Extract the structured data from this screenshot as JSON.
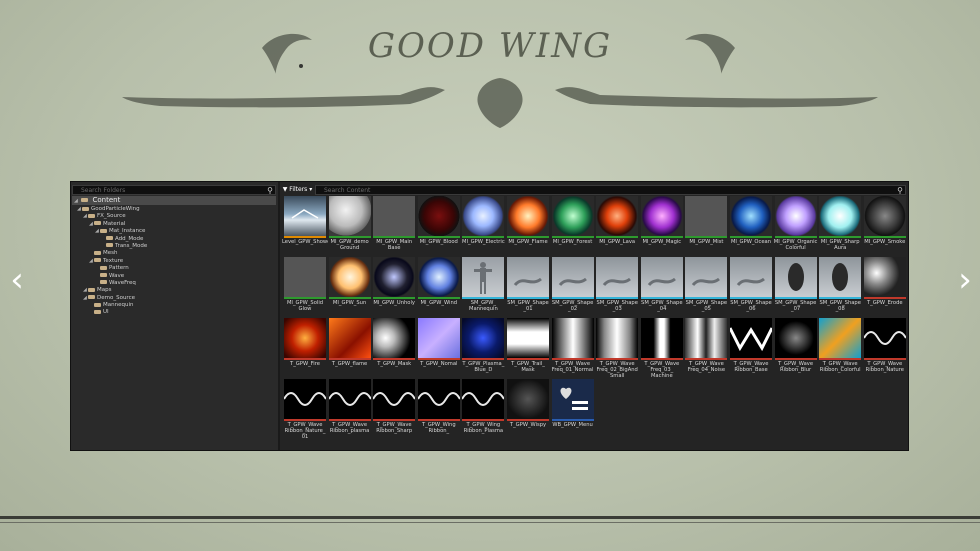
{
  "title": "GOOD WING",
  "browser": {
    "search_folders_placeholder": "Search Folders",
    "search_content_placeholder": "Search Content",
    "filters_label": "▼ Filters ▾",
    "content_label": "Content",
    "tree": [
      {
        "label": "GoodParticleWing",
        "depth": 1,
        "expanded": true
      },
      {
        "label": "FX_Source",
        "depth": 2,
        "expanded": true
      },
      {
        "label": "Material",
        "depth": 3,
        "expanded": true
      },
      {
        "label": "Mat_Instance",
        "depth": 4,
        "expanded": true
      },
      {
        "label": "Add_Mode",
        "depth": 5,
        "expanded": false
      },
      {
        "label": "Trans_Mode",
        "depth": 5,
        "expanded": false
      },
      {
        "label": "Mesh",
        "depth": 3,
        "expanded": false
      },
      {
        "label": "Texture",
        "depth": 3,
        "expanded": true
      },
      {
        "label": "Pattern",
        "depth": 4,
        "expanded": false
      },
      {
        "label": "Wave",
        "depth": 4,
        "expanded": false
      },
      {
        "label": "WaveFreq",
        "depth": 4,
        "expanded": false
      },
      {
        "label": "Maps",
        "depth": 2,
        "expanded": true
      },
      {
        "label": "Demo_Source",
        "depth": 2,
        "expanded": true
      },
      {
        "label": "Mannequin",
        "depth": 3,
        "expanded": false
      },
      {
        "label": "UI",
        "depth": 3,
        "expanded": false
      }
    ],
    "assets": [
      {
        "label": "Level_GPW_Showcase_Interaction",
        "bar": "#e08a00",
        "kind": "level"
      },
      {
        "label": "MI_GPW_demo Ground",
        "bar": "#2e9a2e",
        "kind": "sphere-white"
      },
      {
        "label": "MI_GPW_Main Base",
        "bar": "#2e9a2e",
        "kind": "checker"
      },
      {
        "label": "MI_GPW_Blood",
        "bar": "#2e9a2e",
        "kind": "blood"
      },
      {
        "label": "MI_GPW_Electric",
        "bar": "#2e9a2e",
        "kind": "electric"
      },
      {
        "label": "MI_GPW_Flame",
        "bar": "#2e9a2e",
        "kind": "flame"
      },
      {
        "label": "MI_GPW_Forest",
        "bar": "#2e9a2e",
        "kind": "forest"
      },
      {
        "label": "MI_GPW_Lava",
        "bar": "#2e9a2e",
        "kind": "lava"
      },
      {
        "label": "MI_GPW_Magic",
        "bar": "#2e9a2e",
        "kind": "magic"
      },
      {
        "label": "MI_GPW_Mist",
        "bar": "#2e9a2e",
        "kind": "checker"
      },
      {
        "label": "MI_GPW_Ocean",
        "bar": "#2e9a2e",
        "kind": "ocean"
      },
      {
        "label": "MI_GPW_Organic Colorful",
        "bar": "#2e9a2e",
        "kind": "organic"
      },
      {
        "label": "MI_GPW_Sharp Aura",
        "bar": "#2e9a2e",
        "kind": "aura"
      },
      {
        "label": "MI_GPW_Smoke",
        "bar": "#2e9a2e",
        "kind": "smoke"
      },
      {
        "label": "MI_GPW_Solid Glow",
        "bar": "#2e9a2e",
        "kind": "checker-blue"
      },
      {
        "label": "MI_GPW_Sun",
        "bar": "#2e9a2e",
        "kind": "sun"
      },
      {
        "label": "MI_GPW_Unholy",
        "bar": "#2e9a2e",
        "kind": "unholy"
      },
      {
        "label": "MI_GPW_Wind",
        "bar": "#2e9a2e",
        "kind": "wind"
      },
      {
        "label": "SM_GPW_ Mannequin",
        "bar": "#34b4d8",
        "kind": "mannequin"
      },
      {
        "label": "SM_GPW_Shape _01",
        "bar": "#34b4d8",
        "kind": "shape"
      },
      {
        "label": "SM_GPW_Shape _02",
        "bar": "#34b4d8",
        "kind": "shape"
      },
      {
        "label": "SM_GPW_Shape _03",
        "bar": "#34b4d8",
        "kind": "shape"
      },
      {
        "label": "SM_GPW_Shape _04",
        "bar": "#34b4d8",
        "kind": "shape"
      },
      {
        "label": "SM_GPW_Shape _05",
        "bar": "#34b4d8",
        "kind": "shape"
      },
      {
        "label": "SM_GPW_Shape _06",
        "bar": "#34b4d8",
        "kind": "shape"
      },
      {
        "label": "SM_GPW_Shape _07",
        "bar": "#34b4d8",
        "kind": "shape-dark"
      },
      {
        "label": "SM_GPW_Shape _08",
        "bar": "#34b4d8",
        "kind": "shape-dark"
      },
      {
        "label": "T_GPW_Erode",
        "bar": "#c0392b",
        "kind": "erode"
      },
      {
        "label": "T_GPW_Fire",
        "bar": "#c0392b",
        "kind": "fire"
      },
      {
        "label": "T_GPW_flame",
        "bar": "#c0392b",
        "kind": "flametex"
      },
      {
        "label": "T_GPW_Mask",
        "bar": "#c0392b",
        "kind": "mask"
      },
      {
        "label": "T_GPW_Nomal",
        "bar": "#c0392b",
        "kind": "normal"
      },
      {
        "label": "T_GPW_Plasma_ Blue_D",
        "bar": "#c0392b",
        "kind": "plasma"
      },
      {
        "label": "T_GPW_Trail_ Mask",
        "bar": "#c0392b",
        "kind": "trailmask"
      },
      {
        "label": "T_GPW_Wave Freq_01_Normal",
        "bar": "#c0392b",
        "kind": "freq1"
      },
      {
        "label": "T_GPW_Wave Freq_02_BigAnd Small",
        "bar": "#c0392b",
        "kind": "freq2"
      },
      {
        "label": "T_GPW_Wave Freq_03_ Machine",
        "bar": "#c0392b",
        "kind": "freq3"
      },
      {
        "label": "T_GPW_Wave Freq_04_Noise",
        "bar": "#c0392b",
        "kind": "freq4"
      },
      {
        "label": "T_GPW_Wave Ribbon_Base",
        "bar": "#c0392b",
        "kind": "ribbonbase"
      },
      {
        "label": "T_GPW_Wave Ribbon_Blur",
        "bar": "#c0392b",
        "kind": "ribbonblur"
      },
      {
        "label": "T_GPW_Wave Ribbon_Colorful",
        "bar": "#c0392b",
        "kind": "ribboncolor"
      },
      {
        "label": "T_GPW_Wave Ribbon_Nature",
        "bar": "#c0392b",
        "kind": "ribbonnature"
      },
      {
        "label": "T_GPW_Wave Ribbon_Nature_ 01",
        "bar": "#c0392b",
        "kind": "ribbonnature2"
      },
      {
        "label": "T_GPW_Wave Ribbon_plasma",
        "bar": "#c0392b",
        "kind": "ribbonplasma"
      },
      {
        "label": "T_GPW_Wave Ribbon_Sharp",
        "bar": "#c0392b",
        "kind": "ribbonsharp"
      },
      {
        "label": "T_GPW_Wing Ribbon_",
        "bar": "#c0392b",
        "kind": "wing1"
      },
      {
        "label": "T_GPW_Wing Ribbon_Plasma",
        "bar": "#c0392b",
        "kind": "wing2"
      },
      {
        "label": "T_GPW_Wispy",
        "bar": "#c0392b",
        "kind": "wispy"
      },
      {
        "label": "WB_GPW_Menu",
        "bar": "#2a5db0",
        "kind": "menu"
      }
    ]
  },
  "nav": {
    "prev": "‹",
    "next": "›"
  }
}
